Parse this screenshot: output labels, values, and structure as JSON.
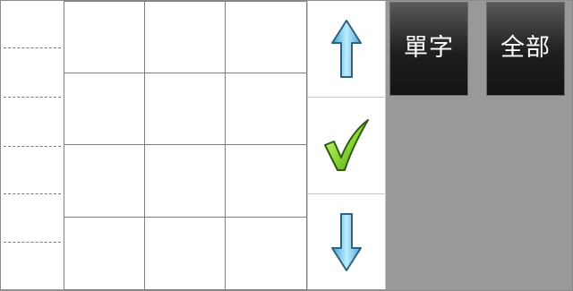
{
  "buttons": {
    "single_char_label": "單字",
    "all_label": "全部"
  },
  "icons": {
    "up": "arrow-up-icon",
    "confirm": "checkmark-icon",
    "down": "arrow-down-icon"
  },
  "colors": {
    "arrow_fill": "#6fc3e6",
    "check_fill": "#8fd43a",
    "button_dark": "#1e1e1e",
    "background": "#999999"
  },
  "grid": {
    "rows": 4,
    "columns": 3,
    "cells": [
      "",
      "",
      "",
      "",
      "",
      "",
      "",
      "",
      "",
      "",
      "",
      ""
    ]
  }
}
